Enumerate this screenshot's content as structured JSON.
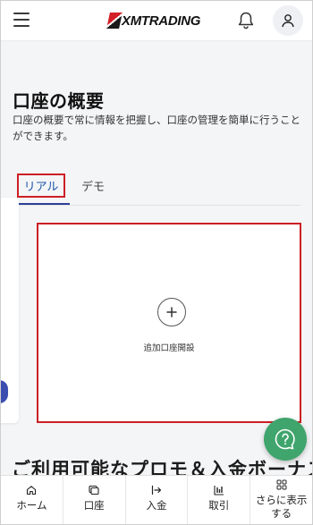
{
  "header": {
    "logo_text": "XMTRADING",
    "icons": {
      "menu": "hamburger-icon",
      "notifications": "bell-icon",
      "account": "user-icon"
    }
  },
  "page": {
    "title": "口座の概要",
    "description": "口座の概要で常に情報を把握し、口座の管理を簡単に行うことができます。"
  },
  "tabs": [
    {
      "label": "リアル",
      "active": true
    },
    {
      "label": "デモ",
      "active": false
    }
  ],
  "add_account": {
    "label": "追加口座開設",
    "icon": "plus-icon"
  },
  "help": {
    "icon": "question-icon"
  },
  "bonus_section": {
    "heading": "ご利用可能なプロモ＆入金ボーナス"
  },
  "bottom_nav": [
    {
      "label": "ホーム",
      "icon": "home-icon"
    },
    {
      "label": "口座",
      "icon": "accounts-icon"
    },
    {
      "label": "入金",
      "icon": "deposit-icon"
    },
    {
      "label": "取引",
      "icon": "trade-icon"
    },
    {
      "label": "さらに表示する",
      "icon": "grid-icon"
    }
  ],
  "colors": {
    "highlight_red": "#cc1f26",
    "active_tab_underline": "#2d3e9a",
    "help_green": "#3fa56c",
    "brand_red": "#d31f26"
  }
}
